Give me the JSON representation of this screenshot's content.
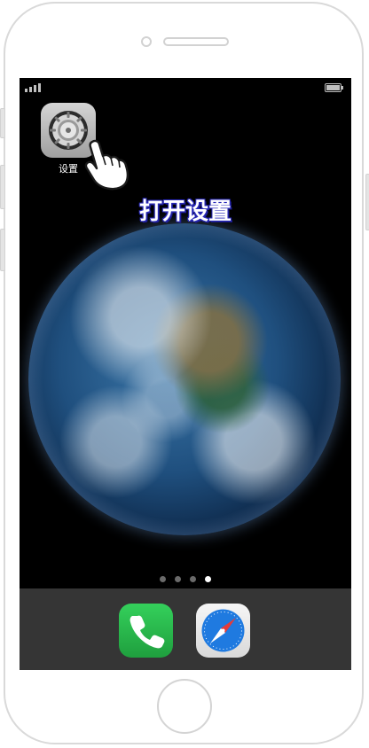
{
  "app_settings": {
    "label": "设置",
    "icon": "gear-icon"
  },
  "instruction": {
    "text": "打开设置"
  },
  "page_indicator": {
    "count": 4,
    "active_index": 3
  },
  "dock": {
    "apps": [
      {
        "icon": "phone-icon"
      },
      {
        "icon": "safari-icon"
      }
    ]
  },
  "colors": {
    "wallpaper_black": "#000000",
    "instruction_outline": "#2a2ab8",
    "phone_green": "#34d05b",
    "safari_blue": "#1f7ae0",
    "frame_gray": "#d9d9d9"
  },
  "status_icons": [
    "signal-bars-icon",
    "battery-icon"
  ],
  "hand_icon": "hand-pointer-icon"
}
